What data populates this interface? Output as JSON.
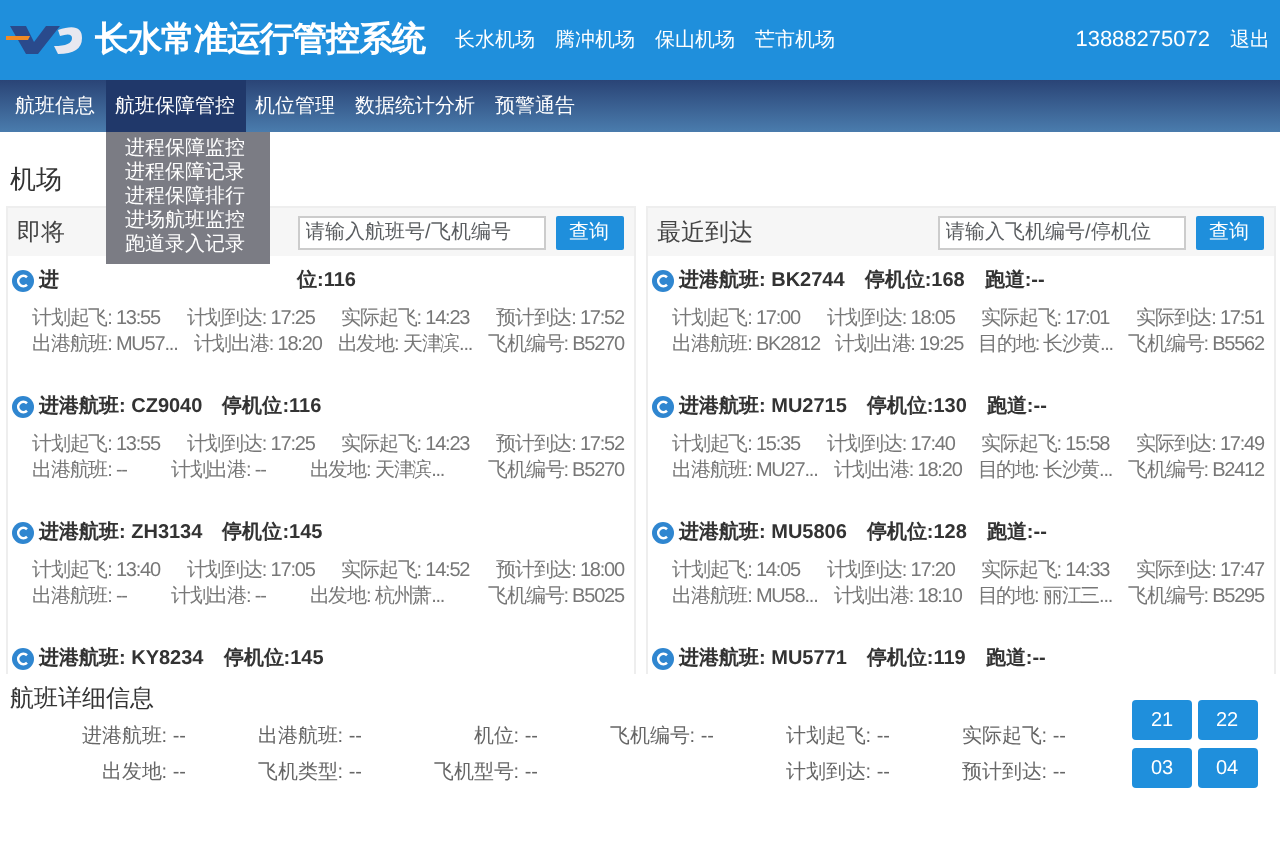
{
  "header": {
    "title": "长水常准运行管控系统",
    "airports": [
      "长水机场",
      "腾冲机场",
      "保山机场",
      "芒市机场"
    ],
    "user": "13888275072",
    "logout": "退出"
  },
  "nav": [
    {
      "label": "航班信息",
      "selected": false
    },
    {
      "label": "航班保障管控",
      "selected": true,
      "menu": [
        "进程保障监控",
        "进程保障记录",
        "进程保障排行",
        "进场航班监控",
        "跑道录入记录"
      ]
    },
    {
      "label": "机位管理",
      "selected": false
    },
    {
      "label": "数据统计分析",
      "selected": false
    },
    {
      "label": "预警通告",
      "selected": false
    }
  ],
  "page_title": "机场",
  "panels": [
    {
      "title": "即将",
      "placeholder": "请输入航班号/飞机编号",
      "button": "查询",
      "flights": [
        {
          "covered": true,
          "header": [
            "进",
            "位:116"
          ],
          "rows": [
            [
              "计划起飞: 13:55",
              "计划到达: 17:25",
              "实际起飞: 14:23",
              "预计到达: 17:52"
            ],
            [
              "出港航班: MU57...",
              "计划出港: 18:20",
              "出发地: 天津滨...",
              "飞机编号: B5270"
            ]
          ]
        },
        {
          "covered": false,
          "header": [
            "进港航班: CZ9040",
            "停机位:116"
          ],
          "rows": [
            [
              "计划起飞: 13:55",
              "计划到达: 17:25",
              "实际起飞: 14:23",
              "预计到达: 17:52"
            ],
            [
              "出港航班: --",
              "计划出港: --",
              "出发地: 天津滨...",
              "飞机编号: B5270"
            ]
          ]
        },
        {
          "covered": false,
          "header": [
            "进港航班: ZH3134",
            "停机位:145"
          ],
          "rows": [
            [
              "计划起飞: 13:40",
              "计划到达: 17:05",
              "实际起飞: 14:52",
              "预计到达: 18:00"
            ],
            [
              "出港航班: --",
              "计划出港: --",
              "出发地: 杭州萧...",
              "飞机编号: B5025"
            ]
          ]
        },
        {
          "covered": false,
          "header": [
            "进港航班: KY8234",
            "停机位:145"
          ]
        }
      ]
    },
    {
      "title": "最近到达",
      "placeholder": "请输入飞机编号/停机位",
      "button": "查询",
      "flights": [
        {
          "covered": false,
          "header": [
            "进港航班: BK2744",
            "停机位:168",
            "跑道:--"
          ],
          "rows": [
            [
              "计划起飞: 17:00",
              "计划到达: 18:05",
              "实际起飞: 17:01",
              "实际到达: 17:51"
            ],
            [
              "出港航班: BK2812",
              "计划出港: 19:25",
              "目的地: 长沙黄...",
              "飞机编号: B5562"
            ]
          ]
        },
        {
          "covered": false,
          "header": [
            "进港航班: MU2715",
            "停机位:130",
            "跑道:--"
          ],
          "rows": [
            [
              "计划起飞: 15:35",
              "计划到达: 17:40",
              "实际起飞: 15:58",
              "实际到达: 17:49"
            ],
            [
              "出港航班: MU27...",
              "计划出港: 18:20",
              "目的地: 长沙黄...",
              "飞机编号: B2412"
            ]
          ]
        },
        {
          "covered": false,
          "header": [
            "进港航班: MU5806",
            "停机位:128",
            "跑道:--"
          ],
          "rows": [
            [
              "计划起飞: 14:05",
              "计划到达: 17:20",
              "实际起飞: 14:33",
              "实际到达: 17:47"
            ],
            [
              "出港航班: MU58...",
              "计划出港: 18:10",
              "目的地: 丽江三...",
              "飞机编号: B5295"
            ]
          ]
        },
        {
          "covered": false,
          "header": [
            "进港航班: MU5771",
            "停机位:119",
            "跑道:--"
          ]
        }
      ]
    }
  ],
  "details": {
    "title": "航班详细信息",
    "columns": [
      [
        "进港航班: --",
        "出发地: --"
      ],
      [
        "出港航班: --",
        "飞机类型: --"
      ],
      [
        "机位: --",
        "飞机型号: --"
      ],
      [
        "飞机编号: --"
      ],
      [
        "计划起飞: --",
        "计划到达: --"
      ],
      [
        "实际起飞: --",
        "预计到达: --"
      ]
    ],
    "buttons": [
      "21",
      "22",
      "03",
      "04"
    ]
  }
}
